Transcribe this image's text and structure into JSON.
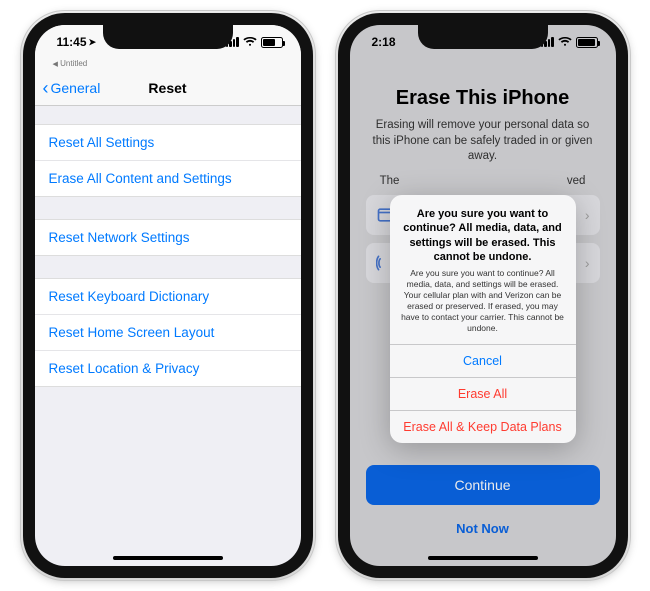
{
  "left": {
    "status": {
      "time": "11:45"
    },
    "tab_label": "Untitled",
    "nav": {
      "back": "General",
      "title": "Reset"
    },
    "group1": [
      "Reset All Settings",
      "Erase All Content and Settings"
    ],
    "group2": [
      "Reset Network Settings"
    ],
    "group3": [
      "Reset Keyboard Dictionary",
      "Reset Home Screen Layout",
      "Reset Location & Privacy"
    ]
  },
  "right": {
    "status": {
      "time": "2:18"
    },
    "title": "Erase This iPhone",
    "subtitle": "Erasing will remove your personal data so this iPhone can be safely traded in or given away.",
    "partial_line_left": "The",
    "partial_line_right": "ved",
    "buttons": {
      "continue": "Continue",
      "notnow": "Not Now"
    },
    "alert": {
      "title": "Are you sure you want to continue? All media, data, and settings will be erased. This cannot be undone.",
      "message": "Are you sure you want to continue? All media, data, and settings will be erased. Your cellular plan with  and Verizon can be erased or preserved. If erased, you may have to contact your carrier.\nThis cannot be undone.",
      "cancel": "Cancel",
      "erase_all": "Erase All",
      "erase_keep": "Erase All & Keep Data Plans"
    }
  }
}
